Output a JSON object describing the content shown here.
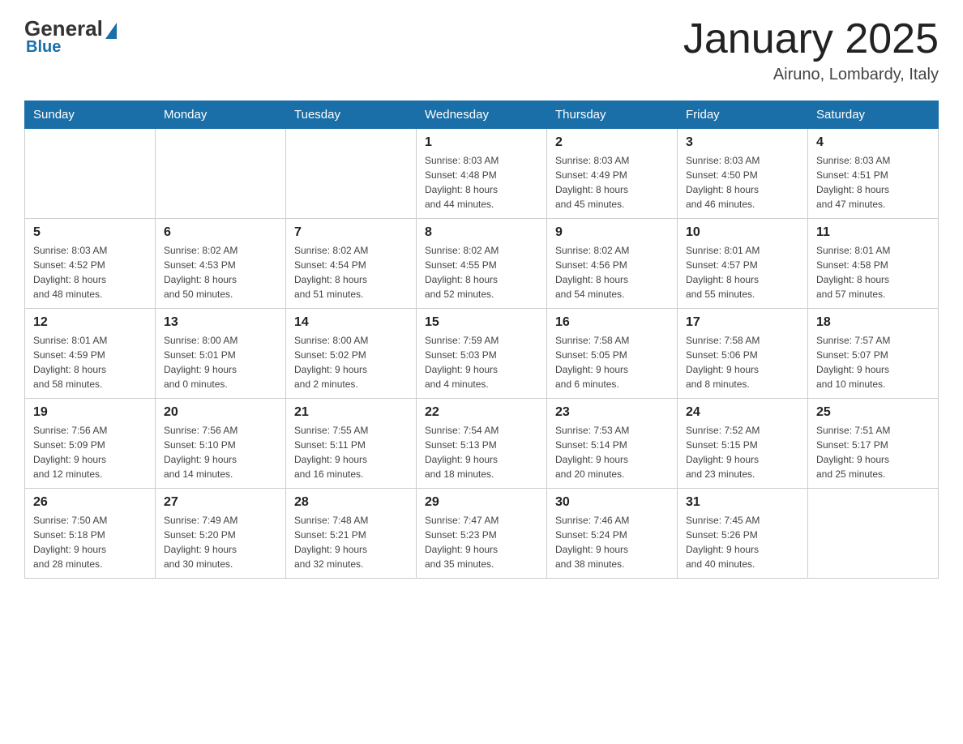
{
  "header": {
    "logo": {
      "general": "General",
      "blue": "Blue"
    },
    "title": "January 2025",
    "location": "Airuno, Lombardy, Italy"
  },
  "days_of_week": [
    "Sunday",
    "Monday",
    "Tuesday",
    "Wednesday",
    "Thursday",
    "Friday",
    "Saturday"
  ],
  "weeks": [
    [
      {
        "day": "",
        "info": ""
      },
      {
        "day": "",
        "info": ""
      },
      {
        "day": "",
        "info": ""
      },
      {
        "day": "1",
        "info": "Sunrise: 8:03 AM\nSunset: 4:48 PM\nDaylight: 8 hours\nand 44 minutes."
      },
      {
        "day": "2",
        "info": "Sunrise: 8:03 AM\nSunset: 4:49 PM\nDaylight: 8 hours\nand 45 minutes."
      },
      {
        "day": "3",
        "info": "Sunrise: 8:03 AM\nSunset: 4:50 PM\nDaylight: 8 hours\nand 46 minutes."
      },
      {
        "day": "4",
        "info": "Sunrise: 8:03 AM\nSunset: 4:51 PM\nDaylight: 8 hours\nand 47 minutes."
      }
    ],
    [
      {
        "day": "5",
        "info": "Sunrise: 8:03 AM\nSunset: 4:52 PM\nDaylight: 8 hours\nand 48 minutes."
      },
      {
        "day": "6",
        "info": "Sunrise: 8:02 AM\nSunset: 4:53 PM\nDaylight: 8 hours\nand 50 minutes."
      },
      {
        "day": "7",
        "info": "Sunrise: 8:02 AM\nSunset: 4:54 PM\nDaylight: 8 hours\nand 51 minutes."
      },
      {
        "day": "8",
        "info": "Sunrise: 8:02 AM\nSunset: 4:55 PM\nDaylight: 8 hours\nand 52 minutes."
      },
      {
        "day": "9",
        "info": "Sunrise: 8:02 AM\nSunset: 4:56 PM\nDaylight: 8 hours\nand 54 minutes."
      },
      {
        "day": "10",
        "info": "Sunrise: 8:01 AM\nSunset: 4:57 PM\nDaylight: 8 hours\nand 55 minutes."
      },
      {
        "day": "11",
        "info": "Sunrise: 8:01 AM\nSunset: 4:58 PM\nDaylight: 8 hours\nand 57 minutes."
      }
    ],
    [
      {
        "day": "12",
        "info": "Sunrise: 8:01 AM\nSunset: 4:59 PM\nDaylight: 8 hours\nand 58 minutes."
      },
      {
        "day": "13",
        "info": "Sunrise: 8:00 AM\nSunset: 5:01 PM\nDaylight: 9 hours\nand 0 minutes."
      },
      {
        "day": "14",
        "info": "Sunrise: 8:00 AM\nSunset: 5:02 PM\nDaylight: 9 hours\nand 2 minutes."
      },
      {
        "day": "15",
        "info": "Sunrise: 7:59 AM\nSunset: 5:03 PM\nDaylight: 9 hours\nand 4 minutes."
      },
      {
        "day": "16",
        "info": "Sunrise: 7:58 AM\nSunset: 5:05 PM\nDaylight: 9 hours\nand 6 minutes."
      },
      {
        "day": "17",
        "info": "Sunrise: 7:58 AM\nSunset: 5:06 PM\nDaylight: 9 hours\nand 8 minutes."
      },
      {
        "day": "18",
        "info": "Sunrise: 7:57 AM\nSunset: 5:07 PM\nDaylight: 9 hours\nand 10 minutes."
      }
    ],
    [
      {
        "day": "19",
        "info": "Sunrise: 7:56 AM\nSunset: 5:09 PM\nDaylight: 9 hours\nand 12 minutes."
      },
      {
        "day": "20",
        "info": "Sunrise: 7:56 AM\nSunset: 5:10 PM\nDaylight: 9 hours\nand 14 minutes."
      },
      {
        "day": "21",
        "info": "Sunrise: 7:55 AM\nSunset: 5:11 PM\nDaylight: 9 hours\nand 16 minutes."
      },
      {
        "day": "22",
        "info": "Sunrise: 7:54 AM\nSunset: 5:13 PM\nDaylight: 9 hours\nand 18 minutes."
      },
      {
        "day": "23",
        "info": "Sunrise: 7:53 AM\nSunset: 5:14 PM\nDaylight: 9 hours\nand 20 minutes."
      },
      {
        "day": "24",
        "info": "Sunrise: 7:52 AM\nSunset: 5:15 PM\nDaylight: 9 hours\nand 23 minutes."
      },
      {
        "day": "25",
        "info": "Sunrise: 7:51 AM\nSunset: 5:17 PM\nDaylight: 9 hours\nand 25 minutes."
      }
    ],
    [
      {
        "day": "26",
        "info": "Sunrise: 7:50 AM\nSunset: 5:18 PM\nDaylight: 9 hours\nand 28 minutes."
      },
      {
        "day": "27",
        "info": "Sunrise: 7:49 AM\nSunset: 5:20 PM\nDaylight: 9 hours\nand 30 minutes."
      },
      {
        "day": "28",
        "info": "Sunrise: 7:48 AM\nSunset: 5:21 PM\nDaylight: 9 hours\nand 32 minutes."
      },
      {
        "day": "29",
        "info": "Sunrise: 7:47 AM\nSunset: 5:23 PM\nDaylight: 9 hours\nand 35 minutes."
      },
      {
        "day": "30",
        "info": "Sunrise: 7:46 AM\nSunset: 5:24 PM\nDaylight: 9 hours\nand 38 minutes."
      },
      {
        "day": "31",
        "info": "Sunrise: 7:45 AM\nSunset: 5:26 PM\nDaylight: 9 hours\nand 40 minutes."
      },
      {
        "day": "",
        "info": ""
      }
    ]
  ]
}
